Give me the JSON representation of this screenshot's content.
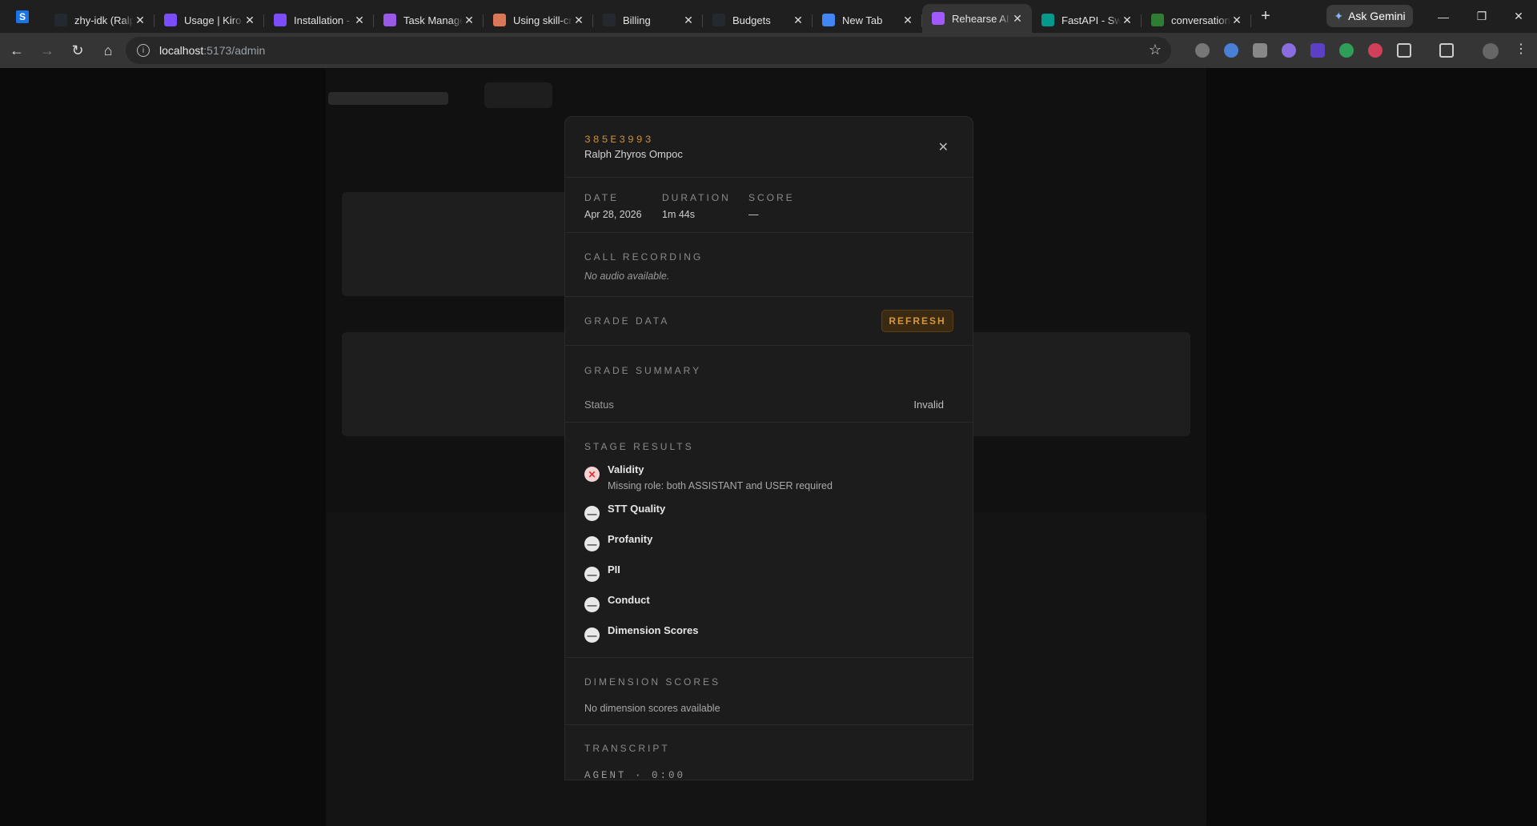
{
  "browser": {
    "tabs": [
      {
        "title": "zhy-idk (Ralph",
        "icon": "github-icon",
        "color": "#24292f"
      },
      {
        "title": "Usage | Kiro",
        "icon": "kiro-icon",
        "color": "#7b4dff"
      },
      {
        "title": "Installation -",
        "icon": "kiro-icon",
        "color": "#7b4dff"
      },
      {
        "title": "Task Manager",
        "icon": "task-icon",
        "color": "#9b59e8"
      },
      {
        "title": "Using skill-cr",
        "icon": "claude-icon",
        "color": "#d97757"
      },
      {
        "title": "Billing",
        "icon": "github-icon",
        "color": "#24292f"
      },
      {
        "title": "Budgets",
        "icon": "github-icon",
        "color": "#24292f"
      },
      {
        "title": "New Tab",
        "icon": "chrome-icon",
        "color": "#4285f4"
      },
      {
        "title": "Rehearse AI",
        "icon": "vite-icon",
        "color": "#a259ff",
        "active": true
      },
      {
        "title": "FastAPI - Sw",
        "icon": "fastapi-icon",
        "color": "#05998b"
      },
      {
        "title": "conversation",
        "icon": "chart-icon",
        "color": "#2e7d32"
      }
    ],
    "gemini_label": "Ask Gemini",
    "url_host": "localhost",
    "url_path": ":5173/admin"
  },
  "modal": {
    "id": "385E3993",
    "name": "Ralph Zhyros Ompoc",
    "meta": [
      {
        "label": "DATE",
        "value": "Apr 28, 2026"
      },
      {
        "label": "DURATION",
        "value": "1m 44s"
      },
      {
        "label": "SCORE",
        "value": "—"
      }
    ],
    "recording_label": "CALL RECORDING",
    "recording_empty": "No audio available.",
    "grade_label": "GRADE DATA",
    "refresh_label": "REFRESH",
    "summary_label": "GRADE SUMMARY",
    "status_key": "Status",
    "status_value": "Invalid",
    "stages_label": "STAGE RESULTS",
    "stages": [
      {
        "name": "Validity",
        "state": "fail",
        "desc": "Missing role: both ASSISTANT and USER required"
      },
      {
        "name": "STT Quality",
        "state": "skipped"
      },
      {
        "name": "Profanity",
        "state": "skipped"
      },
      {
        "name": "PII",
        "state": "skipped"
      },
      {
        "name": "Conduct",
        "state": "skipped"
      },
      {
        "name": "Dimension Scores",
        "state": "skipped"
      }
    ],
    "dims_label": "DIMENSION SCORES",
    "dims_empty": "No dimension scores available",
    "transcript_label": "TRANSCRIPT",
    "transcript_first": "AGENT · 0:00"
  }
}
